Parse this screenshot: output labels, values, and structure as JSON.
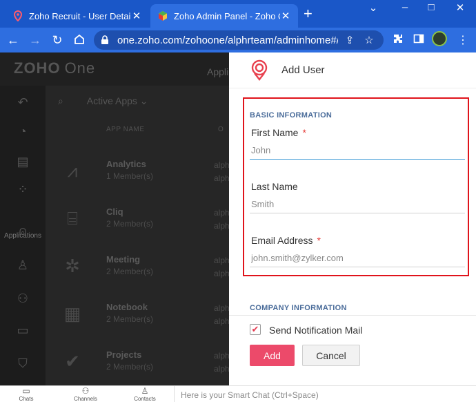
{
  "browser": {
    "tabs": [
      {
        "title": "Zoho Recruit - User Details",
        "active": false
      },
      {
        "title": "Zoho Admin Panel - Zoho One",
        "active": true
      }
    ],
    "new_tab_label": "+",
    "window_controls": [
      "–",
      "□",
      "✕"
    ],
    "url": "one.zoho.com/zohoone/alphrteam/adminhome#/a...",
    "colors": {
      "frame": "#1a57c8",
      "toolbar": "#2e6ee0"
    }
  },
  "app": {
    "logo_text": "ZOHO",
    "logo_suffix": "One",
    "header_tab": "Appli",
    "nav_label": "Applications",
    "filter_label": "Active Apps",
    "columns": [
      "APP NAME",
      "O"
    ],
    "apps": [
      {
        "name": "Analytics",
        "members": "1 Member(s)",
        "owner_line1": "alph",
        "owner_line2": "alph",
        "icon": "analytics-icon"
      },
      {
        "name": "Cliq",
        "members": "2 Member(s)",
        "owner_line1": "alph",
        "owner_line2": "alph",
        "icon": "cliq-icon"
      },
      {
        "name": "Meeting",
        "members": "2 Member(s)",
        "owner_line1": "alph",
        "owner_line2": "alph",
        "icon": "meeting-icon"
      },
      {
        "name": "Notebook",
        "members": "2 Member(s)",
        "owner_line1": "alph",
        "owner_line2": "alph",
        "icon": "notebook-icon"
      },
      {
        "name": "Projects",
        "members": "2 Member(s)",
        "owner_line1": "alph",
        "owner_line2": "alph",
        "icon": "projects-icon"
      }
    ]
  },
  "drawer": {
    "title": "Add User",
    "basic_section": "BASIC INFORMATION",
    "fields": [
      {
        "label": "First Name",
        "required": true,
        "value": "John"
      },
      {
        "label": "Last Name",
        "required": false,
        "value": "Smith"
      },
      {
        "label": "Email Address",
        "required": true,
        "value": "john.smith@zylker.com"
      }
    ],
    "required_marker": "*",
    "company_section": "COMPANY INFORMATION",
    "notification_label": "Send Notification Mail",
    "notification_checked": true,
    "add_label": "Add",
    "cancel_label": "Cancel",
    "colors": {
      "accent": "#ec4a6a",
      "highlight_border": "#e0131b",
      "section": "#4a6c9a"
    }
  },
  "bottombar": {
    "items": [
      "Chats",
      "Channels",
      "Contacts"
    ],
    "smartchat_placeholder": "Here is your Smart Chat (Ctrl+Space)"
  }
}
